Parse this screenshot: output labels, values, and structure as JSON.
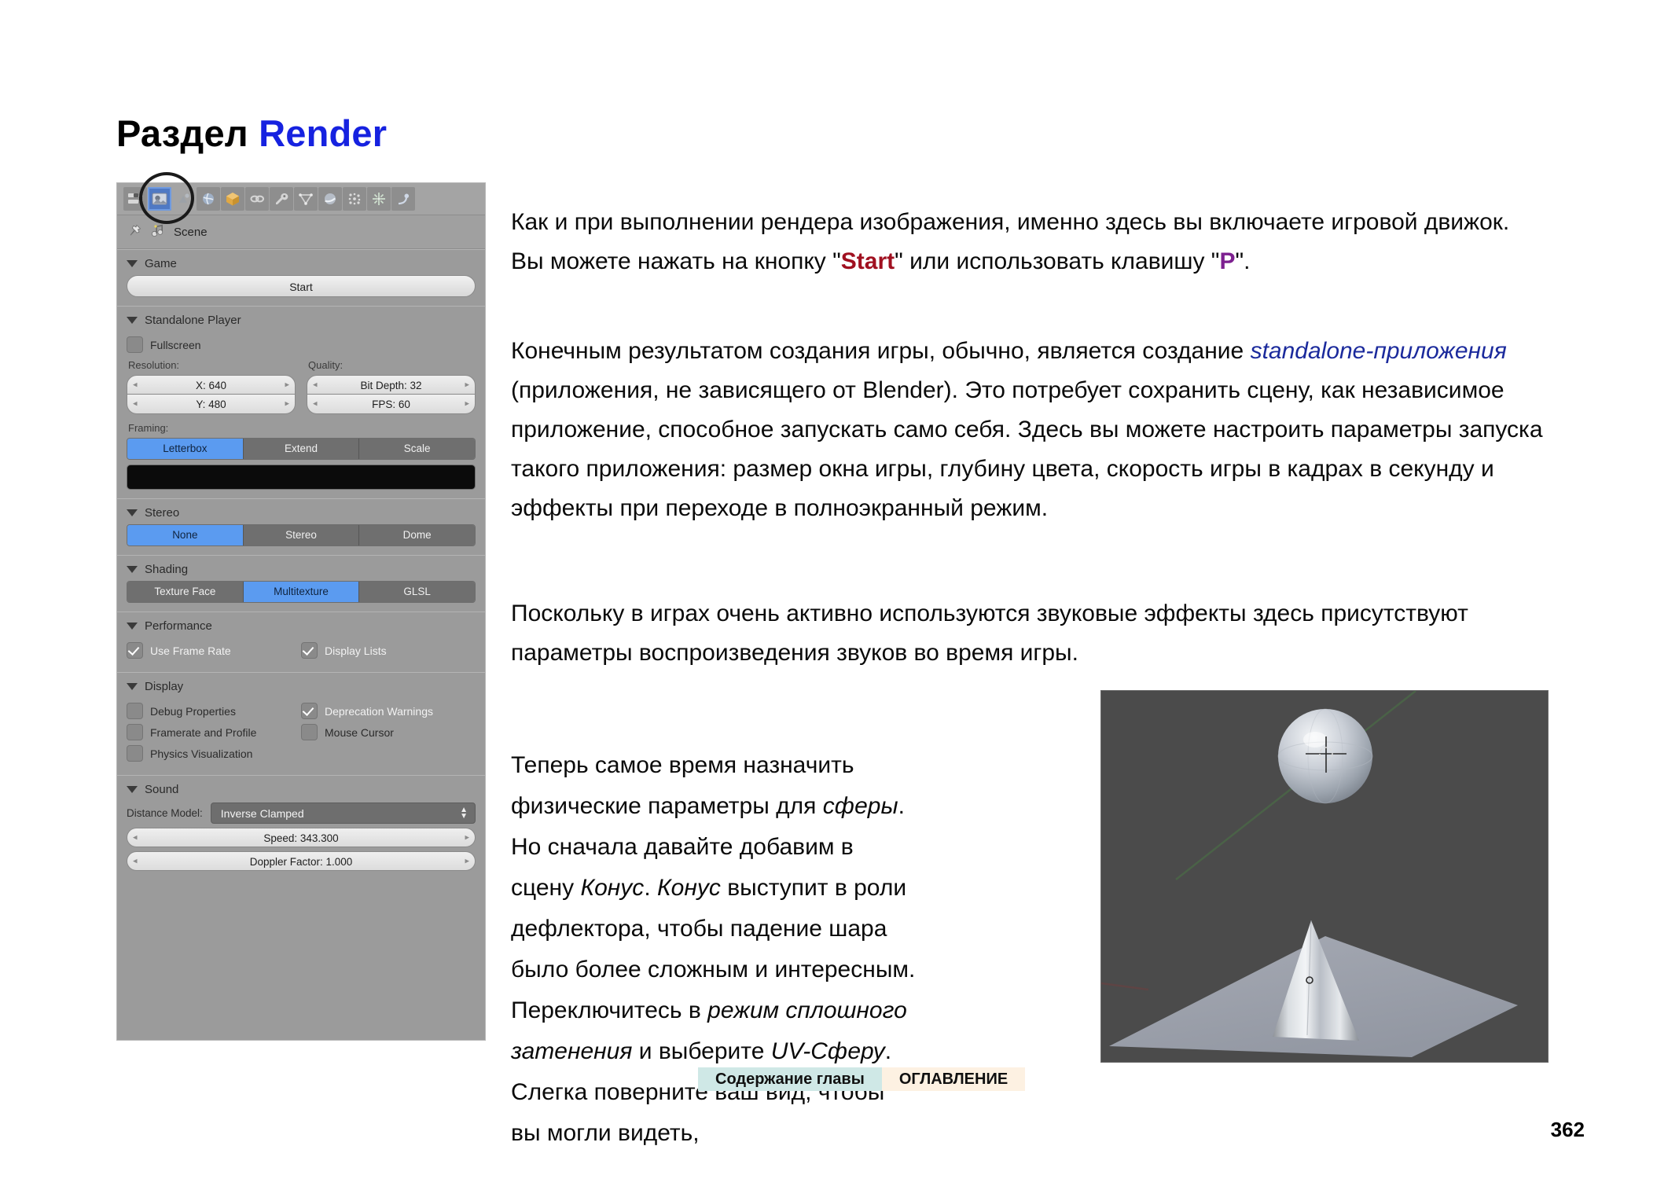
{
  "page": {
    "title_prefix": "Раздел ",
    "title_accent": "Render",
    "number": "362",
    "accent_color": "#1622e0"
  },
  "properties_panel": {
    "tabs": [
      {
        "name": "render-slots-icon",
        "selected": false
      },
      {
        "name": "render-icon",
        "selected": true
      },
      {
        "name": "scene-icon",
        "selected": false
      },
      {
        "name": "world-icon",
        "selected": false
      },
      {
        "name": "object-icon",
        "selected": false
      },
      {
        "name": "constraints-icon",
        "selected": false
      },
      {
        "name": "modifiers-icon",
        "selected": false
      },
      {
        "name": "data-icon",
        "selected": false
      },
      {
        "name": "material-icon",
        "selected": false
      },
      {
        "name": "texture-icon",
        "selected": false
      },
      {
        "name": "particles-icon",
        "selected": false
      },
      {
        "name": "physics-icon",
        "selected": false
      }
    ],
    "datablock": {
      "name": "Scene"
    },
    "sections": {
      "game": {
        "title": "Game",
        "start_button": "Start"
      },
      "standalone_player": {
        "title": "Standalone Player",
        "fullscreen_label": "Fullscreen",
        "fullscreen_checked": false,
        "resolution_label": "Resolution:",
        "quality_label": "Quality:",
        "res_x": "X: 640",
        "res_y": "Y: 480",
        "bit_depth": "Bit Depth: 32",
        "fps": "FPS: 60",
        "framing_label": "Framing:",
        "framing_options": [
          "Letterbox",
          "Extend",
          "Scale"
        ],
        "framing_selected": "Letterbox",
        "framing_color": "#0b0b0b"
      },
      "stereo": {
        "title": "Stereo",
        "options": [
          "None",
          "Stereo",
          "Dome"
        ],
        "selected": "None"
      },
      "shading": {
        "title": "Shading",
        "options": [
          "Texture Face",
          "Multitexture",
          "GLSL"
        ],
        "selected": "Multitexture"
      },
      "performance": {
        "title": "Performance",
        "items": [
          {
            "label": "Use Frame Rate",
            "checked": true
          },
          {
            "label": "Display Lists",
            "checked": true
          }
        ]
      },
      "display": {
        "title": "Display",
        "items": [
          {
            "label": "Debug Properties",
            "checked": false
          },
          {
            "label": "Deprecation Warnings",
            "checked": true
          },
          {
            "label": "Framerate and Profile",
            "checked": false
          },
          {
            "label": "Mouse Cursor",
            "checked": false
          },
          {
            "label": "Physics Visualization",
            "checked": false
          }
        ]
      },
      "sound": {
        "title": "Sound",
        "distance_model_label": "Distance Model:",
        "distance_model_value": "Inverse Clamped",
        "speed": "Speed: 343.300",
        "doppler": "Doppler Factor: 1.000"
      }
    }
  },
  "content": {
    "paragraph_1": {
      "part_a": "Как и при выполнении рендера изображения, именно здесь вы включаете игровой движок. Вы можете нажать на кнопку \"",
      "kw_start": "Start",
      "part_b": "\" или использовать клавишу \"",
      "kw_p": "P",
      "part_c": "\"."
    },
    "paragraph_2": {
      "part_a": "Конечным результатом создания игры, обычно, является создание ",
      "em_standalone": "standalone-приложения",
      "part_b": " (приложения, не зависящего от Blender). Это потребует сохранить сцену, как независимое приложение, способное запускать само себя. Здесь вы можете настроить параметры запуска такого приложения: размер окна игры, глубину цвета, скорость игры в кадрах в секунду и эффекты при переходе в полноэкранный режим."
    },
    "paragraph_3": "Поскольку в играх очень активно используются звуковые эффекты здесь присутствуют параметры воспроизведения звуков во время игры.",
    "paragraph_4": {
      "part_a": "Теперь самое время назначить физические параметры для ",
      "it_sphere": "сферы",
      "part_b": ". Но сначала давайте добавим в сцену ",
      "it_cone1": "Конус",
      "part_c": ". ",
      "it_cone2": "Конус",
      "part_d": " выступит в роли дефлектора, чтобы падение шара было более сложным и интересным. Переключитесь в ",
      "it_solid": "режим сплошного затенения",
      "part_e": " и выберите ",
      "it_uv": "UV-Сферу",
      "part_f": ". Слегка поверните ваш вид, чтобы вы могли видеть,"
    }
  },
  "viewport": {
    "description": "3D viewport showing a UV sphere above a cone on a plane",
    "background_color": "#4b4b4b",
    "plane_color": "#9fa3ae",
    "objects": [
      "uv-sphere",
      "cone",
      "plane",
      "3d-cursor"
    ]
  },
  "footer": {
    "chapter_contents": "Содержание главы",
    "table_of_contents": "ОГЛАВЛЕНИЕ",
    "teal_color": "#cfe8e6",
    "cream_color": "#fdf1e2"
  }
}
